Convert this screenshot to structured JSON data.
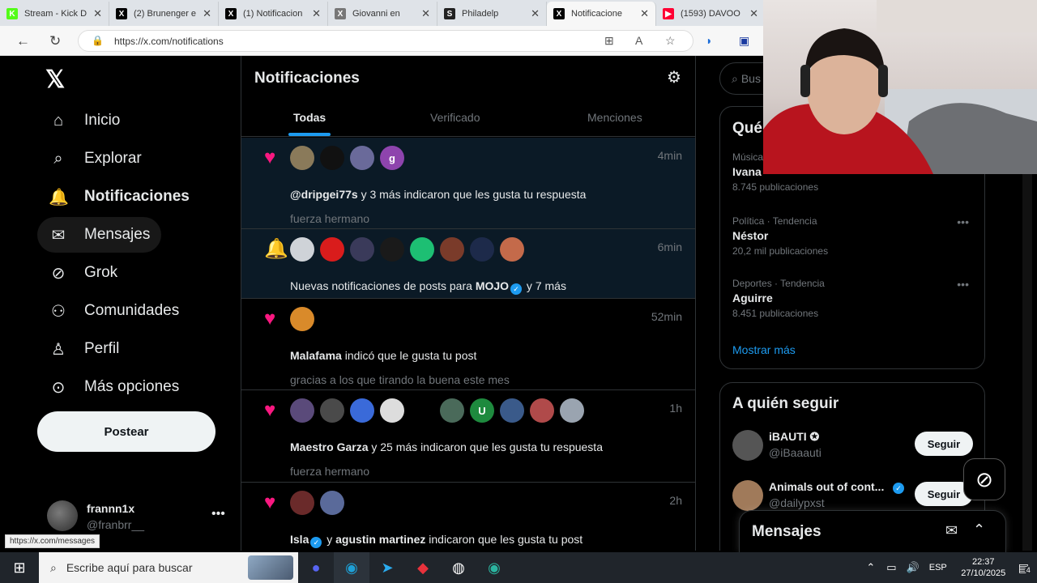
{
  "browser": {
    "tabs": [
      {
        "title": "Stream - Kick D",
        "icon": "kick-icon",
        "color": "#53fc18"
      },
      {
        "title": "(2) Brunenger e",
        "icon": "x-icon",
        "color": "#000000"
      },
      {
        "title": "(1) Notificacion",
        "icon": "x-icon",
        "color": "#000000"
      },
      {
        "title": "Giovanni en",
        "icon": "x-icon",
        "color": "#777777"
      },
      {
        "title": "Philadelp",
        "icon": "s-icon",
        "color": "#222222"
      },
      {
        "title": "Notificacione",
        "icon": "x-icon",
        "color": "#000000"
      },
      {
        "title": "(1593) DAVOO",
        "icon": "youtube-icon",
        "color": "#ff0033"
      }
    ],
    "url": "https://x.com/notifications",
    "status_url": "https://x.com/messages"
  },
  "sidebar": {
    "items": [
      {
        "label": "Inicio",
        "icon": "home-icon"
      },
      {
        "label": "Explorar",
        "icon": "search-icon"
      },
      {
        "label": "Notificaciones",
        "icon": "bell-icon"
      },
      {
        "label": "Mensajes",
        "icon": "mail-icon"
      },
      {
        "label": "Grok",
        "icon": "grok-icon"
      },
      {
        "label": "Comunidades",
        "icon": "communities-icon"
      },
      {
        "label": "Perfil",
        "icon": "person-icon"
      },
      {
        "label": "Más opciones",
        "icon": "more-circle-icon"
      }
    ],
    "post_label": "Postear",
    "profile": {
      "name": "frannn1x",
      "handle": "@franbrr__"
    }
  },
  "feed": {
    "title": "Notificaciones",
    "tabs": [
      "Todas",
      "Verificado",
      "Menciones"
    ],
    "notifications": [
      {
        "kind": "heart",
        "time": "4min",
        "avatars": [
          "#8a7a5a",
          "#111111",
          "#6a6a9a",
          "#8e44ad"
        ],
        "avatar_letter": "g",
        "user": "@dripgei77s",
        "rest": " y 3 más indicaron que les gusta tu respuesta",
        "snippet": "fuerza hermano"
      },
      {
        "kind": "bell",
        "time": "6min",
        "avatars": [
          "#cfd3d8",
          "#d91c1c",
          "#3a3a5a",
          "#1a1a1a",
          "#1dbf73",
          "#7a3b2a",
          "#1d2a4a",
          "#c46a4a"
        ],
        "prefix": "Nuevas notificaciones de posts para ",
        "user": "MOJO",
        "rest": " y 7 más"
      },
      {
        "kind": "heart",
        "time": "52min",
        "avatars": [
          "#d98a2a"
        ],
        "user": "Malafama",
        "rest": " indicó que le gusta tu post",
        "snippet": "gracias a los que tirando la buena este mes"
      },
      {
        "kind": "heart",
        "time": "1h",
        "avatars": [
          "#5a4a7a",
          "#4a4a4a",
          "#3a6ad9",
          "#dddddd",
          "#000000",
          "#4a6a5a",
          "#1e8a3e",
          "#3a5a8a",
          "#b04a4a",
          "#9aa4b0"
        ],
        "avatar_letter": "U",
        "user": "Maestro Garza",
        "rest": " y 25 más indicaron que les gusta tu respuesta",
        "snippet": "fuerza hermano"
      },
      {
        "kind": "heart",
        "time": "2h",
        "avatars": [
          "#6a2a2a",
          "#5a6a9a"
        ],
        "user": "Isla",
        "mid": " y ",
        "user2": "agustin martinez",
        "rest": " indicaron que les gusta tu post"
      }
    ]
  },
  "right": {
    "search_placeholder": "Bus",
    "trends_title": "Qué",
    "trends": [
      {
        "meta": "Música",
        "name": "Ivana",
        "count": "8.745 publicaciones"
      },
      {
        "meta": "Política · Tendencia",
        "name": "Néstor",
        "count": "20,2 mil publicaciones"
      },
      {
        "meta": "Deportes · Tendencia",
        "name": "Aguirre",
        "count": "8.451 publicaciones"
      }
    ],
    "show_more": "Mostrar más",
    "follow_title": "A quién seguir",
    "follow": [
      {
        "name": "iBAUTI ✪",
        "handle": "@iBaaauti",
        "button": "Seguir",
        "color": "#555555"
      },
      {
        "name": "Animals out of cont...",
        "handle": "@dailypxst",
        "button": "Seguir",
        "color": "#a07a5a"
      }
    ]
  },
  "messages_dock": {
    "title": "Mensajes"
  },
  "taskbar": {
    "search": "Escribe aquí para buscar",
    "lang": "ESP",
    "time": "22:37",
    "date": "27/10/2025",
    "notif_count": "4"
  }
}
